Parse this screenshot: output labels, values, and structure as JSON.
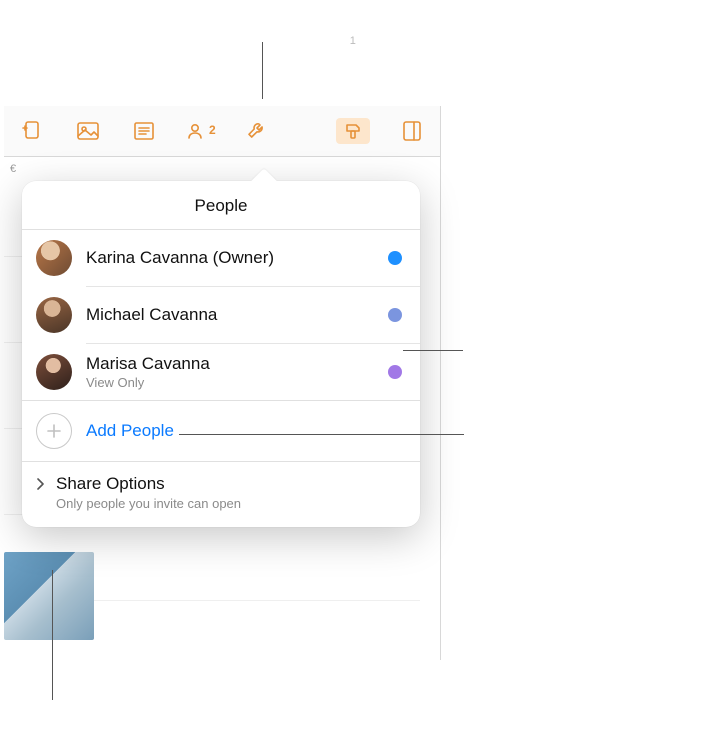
{
  "page_hint": "1",
  "toolbar": {
    "collab_count": "2"
  },
  "ruler": {
    "celll": "€"
  },
  "popover": {
    "title": "People",
    "people": [
      {
        "name": "Karina Cavanna (Owner)",
        "sub": null,
        "dot_color": "#1e90ff"
      },
      {
        "name": "Michael Cavanna",
        "sub": null,
        "dot_color": "#7b95df"
      },
      {
        "name": "Marisa Cavanna",
        "sub": "View Only",
        "dot_color": "#a178e6"
      }
    ],
    "add_label": "Add People",
    "share": {
      "title": "Share Options",
      "sub": "Only people you invite can open"
    }
  }
}
